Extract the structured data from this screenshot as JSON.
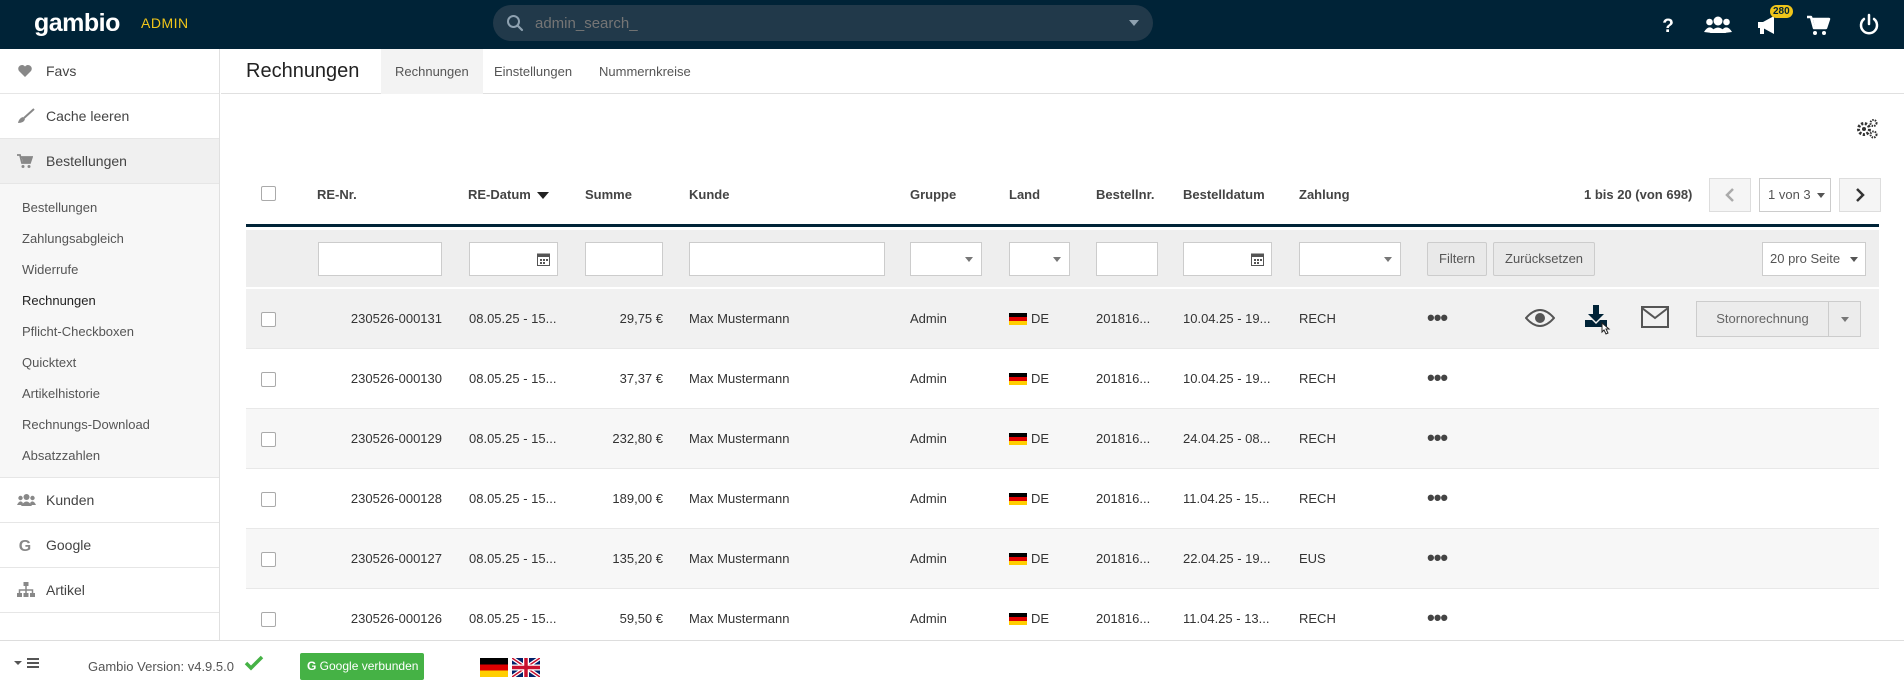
{
  "topbar": {
    "logo": "gambio",
    "admin_label": "ADMIN",
    "search_placeholder": "admin_search_",
    "notification_count": "280"
  },
  "sidebar": {
    "top_items": [
      {
        "label": "Favs",
        "icon": "heart-icon"
      },
      {
        "label": "Cache leeren",
        "icon": "brush-icon"
      },
      {
        "label": "Bestellungen",
        "icon": "cart-icon"
      }
    ],
    "sub_items": [
      "Bestellungen",
      "Zahlungsabgleich",
      "Widerrufe",
      "Rechnungen",
      "Pflicht-Checkboxen",
      "Quicktext",
      "Artikelhistorie",
      "Rechnungs-Download",
      "Absatzzahlen"
    ],
    "bottom_items": [
      {
        "label": "Kunden",
        "icon": "users-icon"
      },
      {
        "label": "Google",
        "icon": "google-icon"
      },
      {
        "label": "Artikel",
        "icon": "sitemap-icon"
      }
    ]
  },
  "header": {
    "title": "Rechnungen",
    "tabs": [
      "Rechnungen",
      "Einstellungen",
      "Nummernkreise"
    ]
  },
  "table": {
    "columns": {
      "re_nr": "RE-Nr.",
      "re_datum": "RE-Datum",
      "summe": "Summe",
      "kunde": "Kunde",
      "gruppe": "Gruppe",
      "land": "Land",
      "bestellnr": "Bestellnr.",
      "bestelldatum": "Bestelldatum",
      "zahlung": "Zahlung"
    },
    "pager": {
      "info": "1 bis 20 (von 698)",
      "page_select": "1 von 3"
    },
    "filter": {
      "filter_button": "Filtern",
      "reset_button": "Zurücksetzen",
      "per_page": "20 pro Seite"
    },
    "storno_button": "Stornorechnung",
    "rows": [
      {
        "re_nr": "230526-000131",
        "re_datum": "08.05.25 - 15...",
        "summe": "29,75 €",
        "kunde": "Max Mustermann",
        "gruppe": "Admin",
        "land": "DE",
        "bestellnr": "201816...",
        "bestelldatum": "10.04.25 - 19...",
        "zahlung": "RECH"
      },
      {
        "re_nr": "230526-000130",
        "re_datum": "08.05.25 - 15...",
        "summe": "37,37 €",
        "kunde": "Max Mustermann",
        "gruppe": "Admin",
        "land": "DE",
        "bestellnr": "201816...",
        "bestelldatum": "10.04.25 - 19...",
        "zahlung": "RECH"
      },
      {
        "re_nr": "230526-000129",
        "re_datum": "08.05.25 - 15...",
        "summe": "232,80 €",
        "kunde": "Max Mustermann",
        "gruppe": "Admin",
        "land": "DE",
        "bestellnr": "201816...",
        "bestelldatum": "24.04.25 - 08...",
        "zahlung": "RECH"
      },
      {
        "re_nr": "230526-000128",
        "re_datum": "08.05.25 - 15...",
        "summe": "189,00 €",
        "kunde": "Max Mustermann",
        "gruppe": "Admin",
        "land": "DE",
        "bestellnr": "201816...",
        "bestelldatum": "11.04.25 - 15...",
        "zahlung": "RECH"
      },
      {
        "re_nr": "230526-000127",
        "re_datum": "08.05.25 - 15...",
        "summe": "135,20 €",
        "kunde": "Max Mustermann",
        "gruppe": "Admin",
        "land": "DE",
        "bestellnr": "201816...",
        "bestelldatum": "22.04.25 - 19...",
        "zahlung": "EUS"
      },
      {
        "re_nr": "230526-000126",
        "re_datum": "08.05.25 - 15...",
        "summe": "59,50 €",
        "kunde": "Max Mustermann",
        "gruppe": "Admin",
        "land": "DE",
        "bestellnr": "201816...",
        "bestelldatum": "11.04.25 - 13...",
        "zahlung": "RECH"
      }
    ]
  },
  "footer": {
    "version": "Gambio Version: v4.9.5.0",
    "google_button": "Google verbunden"
  },
  "colors": {
    "topbar_bg": "#002337",
    "accent_yellow": "#f0c51a",
    "success_green": "#45b245"
  }
}
